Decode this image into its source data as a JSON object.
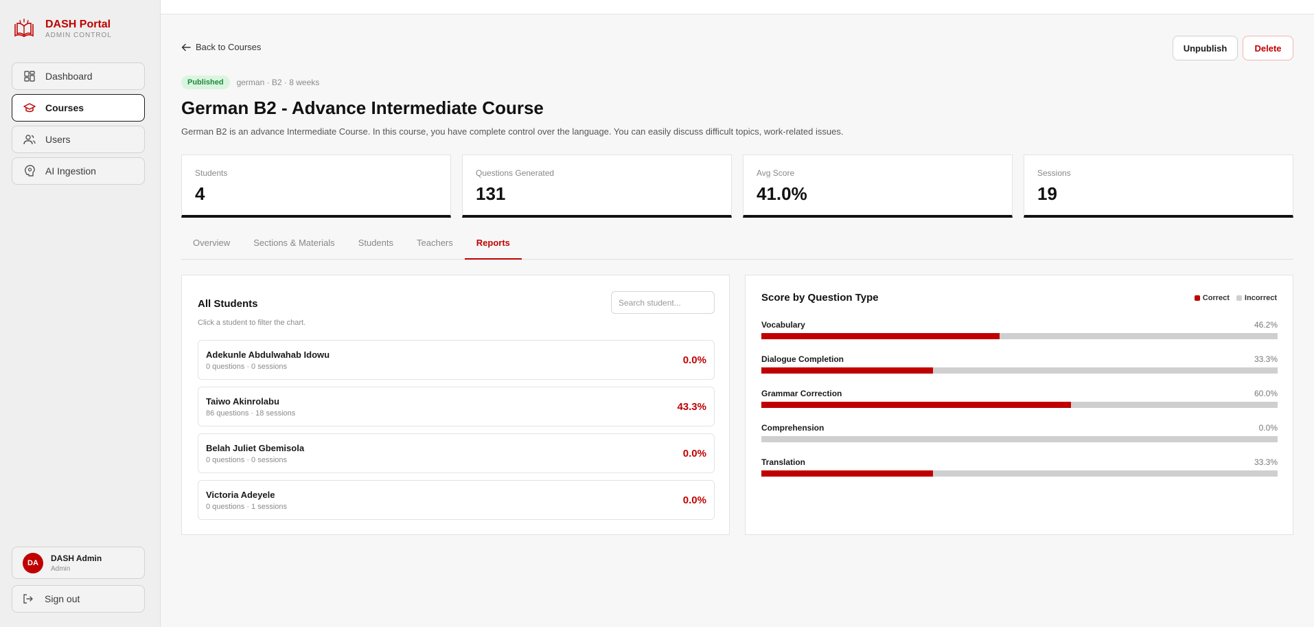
{
  "brand": {
    "name": "DASH Portal",
    "sub": "ADMIN CONTROL"
  },
  "nav": {
    "items": [
      {
        "label": "Dashboard",
        "icon": "dashboard-icon"
      },
      {
        "label": "Courses",
        "icon": "graduation-cap-icon",
        "active": true
      },
      {
        "label": "Users",
        "icon": "users-icon"
      },
      {
        "label": "AI Ingestion",
        "icon": "ai-brain-icon"
      }
    ]
  },
  "user": {
    "initials": "DA",
    "name": "DASH Admin",
    "role": "Admin"
  },
  "signout_label": "Sign out",
  "header": {
    "back_label": "Back to Courses",
    "unpublish_label": "Unpublish",
    "delete_label": "Delete",
    "status": "Published",
    "meta": "german · B2 · 8 weeks",
    "title": "German B2 - Advance Intermediate Course",
    "description": "German B2 is an advance Intermediate Course. In this course, you have complete control over the language. You can easily discuss difficult topics, work-related issues."
  },
  "stats": [
    {
      "label": "Students",
      "value": "4"
    },
    {
      "label": "Questions Generated",
      "value": "131"
    },
    {
      "label": "Avg Score",
      "value": "41.0%"
    },
    {
      "label": "Sessions",
      "value": "19"
    }
  ],
  "tabs": [
    {
      "label": "Overview"
    },
    {
      "label": "Sections & Materials"
    },
    {
      "label": "Students"
    },
    {
      "label": "Teachers"
    },
    {
      "label": "Reports",
      "active": true
    }
  ],
  "students_panel": {
    "title": "All Students",
    "search_placeholder": "Search student...",
    "hint": "Click a student to filter the chart.",
    "students": [
      {
        "name": "Adekunle Abdulwahab Idowu",
        "sub": "0 questions · 0 sessions",
        "score": "0.0%"
      },
      {
        "name": "Taiwo Akinrolabu",
        "sub": "86 questions · 18 sessions",
        "score": "43.3%"
      },
      {
        "name": "Belah Juliet Gbemisola",
        "sub": "0 questions · 0 sessions",
        "score": "0.0%"
      },
      {
        "name": "Victoria Adeyele",
        "sub": "0 questions · 1 sessions",
        "score": "0.0%"
      }
    ]
  },
  "score_panel": {
    "title": "Score by Question Type",
    "legend": {
      "correct": "Correct",
      "incorrect": "Incorrect"
    },
    "colors": {
      "correct": "#c00000",
      "incorrect": "#cfcfcf"
    },
    "types": [
      {
        "label": "Vocabulary",
        "pct_text": "46.2%",
        "value": 46.2
      },
      {
        "label": "Dialogue Completion",
        "pct_text": "33.3%",
        "value": 33.3
      },
      {
        "label": "Grammar Correction",
        "pct_text": "60.0%",
        "value": 60.0
      },
      {
        "label": "Comprehension",
        "pct_text": "0.0%",
        "value": 0.0
      },
      {
        "label": "Translation",
        "pct_text": "33.3%",
        "value": 33.3
      }
    ]
  }
}
